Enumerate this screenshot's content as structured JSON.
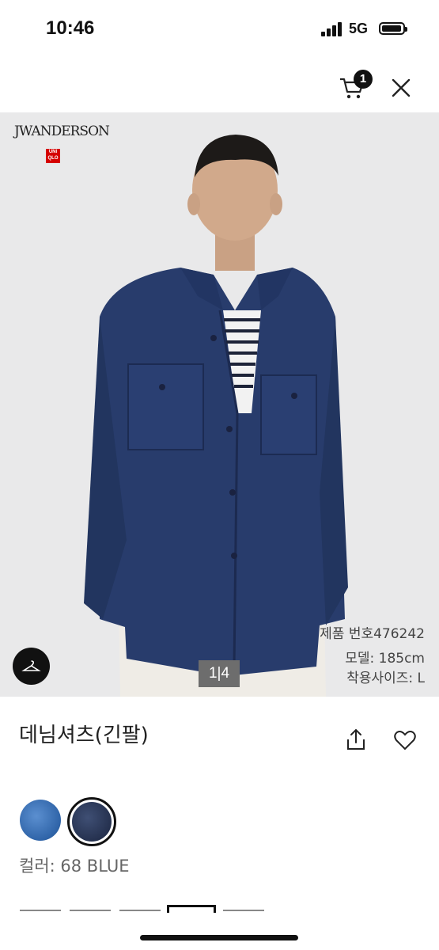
{
  "status": {
    "time": "10:46",
    "network": "5G"
  },
  "header": {
    "cart_count": "1"
  },
  "hero": {
    "brand_line": "JWANDERSON",
    "uniqlo_lines": [
      "UNI",
      "QLO"
    ],
    "product_number": "제품 번호476242",
    "model_height": "모델: 185cm",
    "wear_size": "착용사이즈: L",
    "pager": "1|4"
  },
  "product": {
    "title": "데님셔츠(긴팔)",
    "color_label": "컬러: 68 BLUE"
  },
  "swatches": [
    {
      "name": "light blue denim",
      "color": "#3d74bb"
    },
    {
      "name": "dark blue denim",
      "color": "#25314f"
    }
  ]
}
